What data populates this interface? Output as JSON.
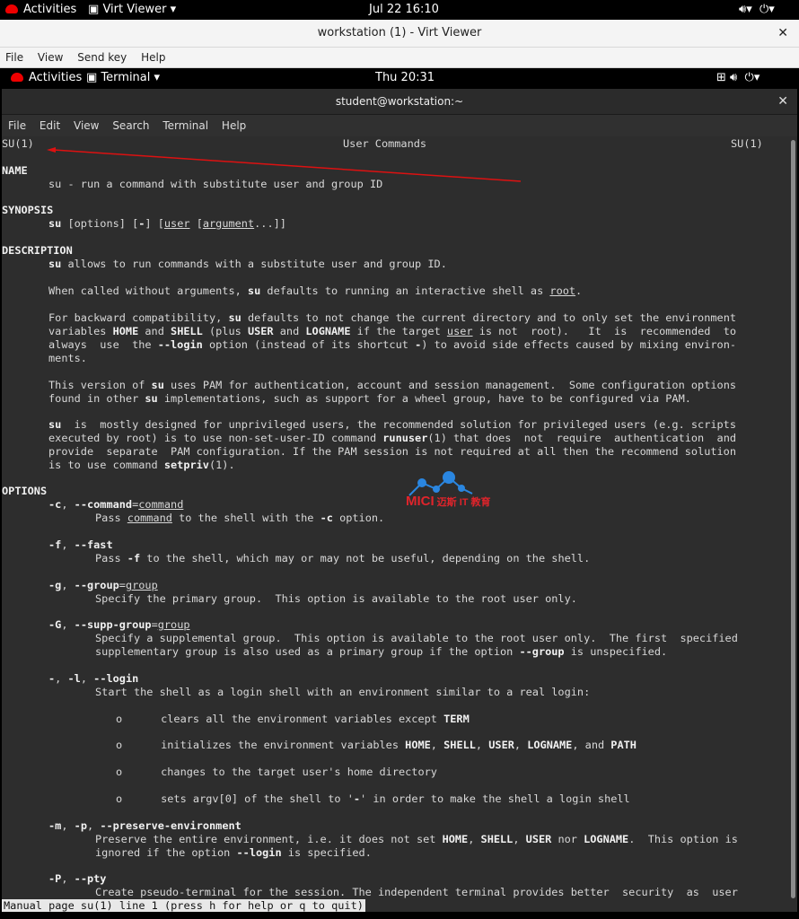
{
  "host_top": {
    "activities": "Activities",
    "app": "Virt Viewer",
    "clock": "Jul 22  16:10"
  },
  "virt_window": {
    "title": "workstation (1) - Virt Viewer",
    "menu": [
      "File",
      "View",
      "Send key",
      "Help"
    ]
  },
  "guest_top": {
    "activities": "Activities",
    "app": "Terminal",
    "clock": "Thu 20:31"
  },
  "terminal": {
    "title": "student@workstation:~",
    "menu": [
      "File",
      "Edit",
      "View",
      "Search",
      "Terminal",
      "Help"
    ]
  },
  "man": {
    "header_left": "SU(1)",
    "header_center": "User Commands",
    "header_right": "SU(1)",
    "name_heading": "NAME",
    "name_text": "su - run a command with substitute user and group ID",
    "synopsis_heading": "SYNOPSIS",
    "description_heading": "DESCRIPTION",
    "options_heading": "OPTIONS",
    "status_line": "Manual page su(1) line 1 (press h for help or q to quit)"
  },
  "watermark": {
    "brand": "MICI",
    "sub": "迈斯 IT 教育"
  }
}
